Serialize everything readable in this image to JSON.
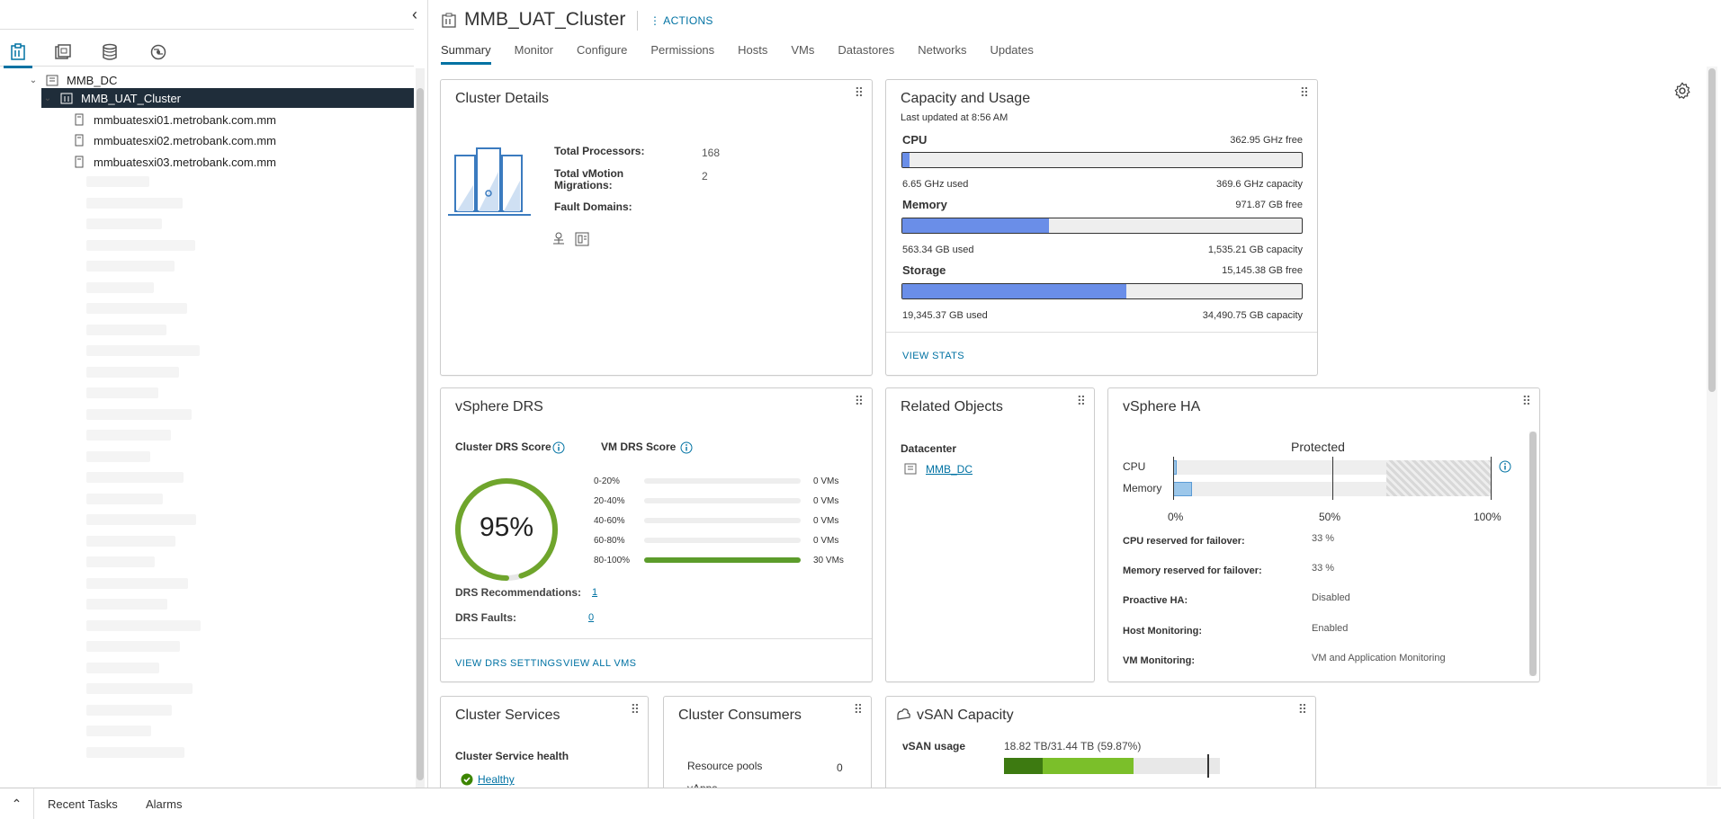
{
  "nav": {
    "tree": {
      "datacenter": "MMB_DC",
      "cluster": "MMB_UAT_Cluster",
      "hosts": [
        "mmbuatesxi01.metrobank.com.mm",
        "mmbuatesxi02.metrobank.com.mm",
        "mmbuatesxi03.metrobank.com.mm"
      ]
    }
  },
  "header": {
    "title": "MMB_UAT_Cluster",
    "actions_label": "ACTIONS",
    "tabs": [
      "Summary",
      "Monitor",
      "Configure",
      "Permissions",
      "Hosts",
      "VMs",
      "Datastores",
      "Networks",
      "Updates"
    ]
  },
  "cluster_details": {
    "title": "Cluster Details",
    "total_processors_label": "Total Processors:",
    "total_processors_value": "168",
    "vmotion_label_1": "Total vMotion",
    "vmotion_label_2": "Migrations:",
    "vmotion_value": "2",
    "fault_domains_label": "Fault Domains:"
  },
  "capacity": {
    "title": "Capacity and Usage",
    "updated": "Last updated at 8:56 AM",
    "cpu": {
      "label": "CPU",
      "free": "362.95 GHz free",
      "used": "6.65 GHz used",
      "capacity": "369.6 GHz capacity",
      "fill_fraction": 0.018
    },
    "memory": {
      "label": "Memory",
      "free": "971.87 GB free",
      "used": "563.34 GB used",
      "capacity": "1,535.21 GB capacity",
      "fill_fraction": 0.367
    },
    "storage": {
      "label": "Storage",
      "free": "15,145.38 GB free",
      "used": "19,345.37 GB used",
      "capacity": "34,490.75 GB capacity",
      "fill_fraction": 0.561
    },
    "view_stats": "VIEW STATS"
  },
  "drs": {
    "title": "vSphere DRS",
    "cluster_score_label": "Cluster DRS Score",
    "vm_score_label": "VM DRS Score",
    "score": "95%",
    "score_fraction": 0.95,
    "distribution": [
      {
        "range": "0-20%",
        "count": "0 VMs",
        "fraction": 0
      },
      {
        "range": "20-40%",
        "count": "0 VMs",
        "fraction": 0
      },
      {
        "range": "40-60%",
        "count": "0 VMs",
        "fraction": 0
      },
      {
        "range": "60-80%",
        "count": "0 VMs",
        "fraction": 0
      },
      {
        "range": "80-100%",
        "count": "30 VMs",
        "fraction": 1
      }
    ],
    "recommendations_label": "DRS Recommendations:",
    "recommendations_value": "1",
    "faults_label": "DRS Faults:",
    "faults_value": "0",
    "view_settings": "VIEW DRS SETTINGS",
    "view_vms": "VIEW ALL VMS"
  },
  "related": {
    "title": "Related Objects",
    "datacenter_label": "Datacenter",
    "datacenter_value": "MMB_DC"
  },
  "ha": {
    "title": "vSphere HA",
    "status": "Protected",
    "cpu_label": "CPU",
    "memory_label": "Memory",
    "axis": [
      "0%",
      "50%",
      "100%"
    ],
    "cpu_used_fraction": 0.01,
    "memory_used_fraction": 0.06,
    "reserved_fraction": 0.33,
    "rows": [
      {
        "label": "CPU reserved for failover:",
        "value": "33 %"
      },
      {
        "label": "Memory reserved for failover:",
        "value": "33 %"
      },
      {
        "label": "Proactive HA:",
        "value": "Disabled"
      },
      {
        "label": "Host Monitoring:",
        "value": "Enabled"
      },
      {
        "label": "VM Monitoring:",
        "value": "VM and Application Monitoring"
      }
    ]
  },
  "services": {
    "title": "Cluster Services",
    "health_label": "Cluster Service health",
    "health_value": "Healthy"
  },
  "consumers": {
    "title": "Cluster Consumers",
    "resource_pools_label": "Resource pools",
    "resource_pools_value": "0",
    "vapps_label": "vApps"
  },
  "vsan": {
    "title": "vSAN Capacity",
    "usage_label": "vSAN usage",
    "usage_value": "18.82 TB/31.44 TB (59.87%)",
    "used_fraction": 0.5987
  },
  "bottom": {
    "recent_tasks": "Recent Tasks",
    "alarms": "Alarms"
  },
  "colors": {
    "accent": "#0072a3",
    "bar_fill": "#6a8ee8",
    "drs_green": "#5c9c2b",
    "vsan_dark": "#3d7a11",
    "vsan_light": "#7bbf2a",
    "selected_row": "#1f2d3a"
  }
}
